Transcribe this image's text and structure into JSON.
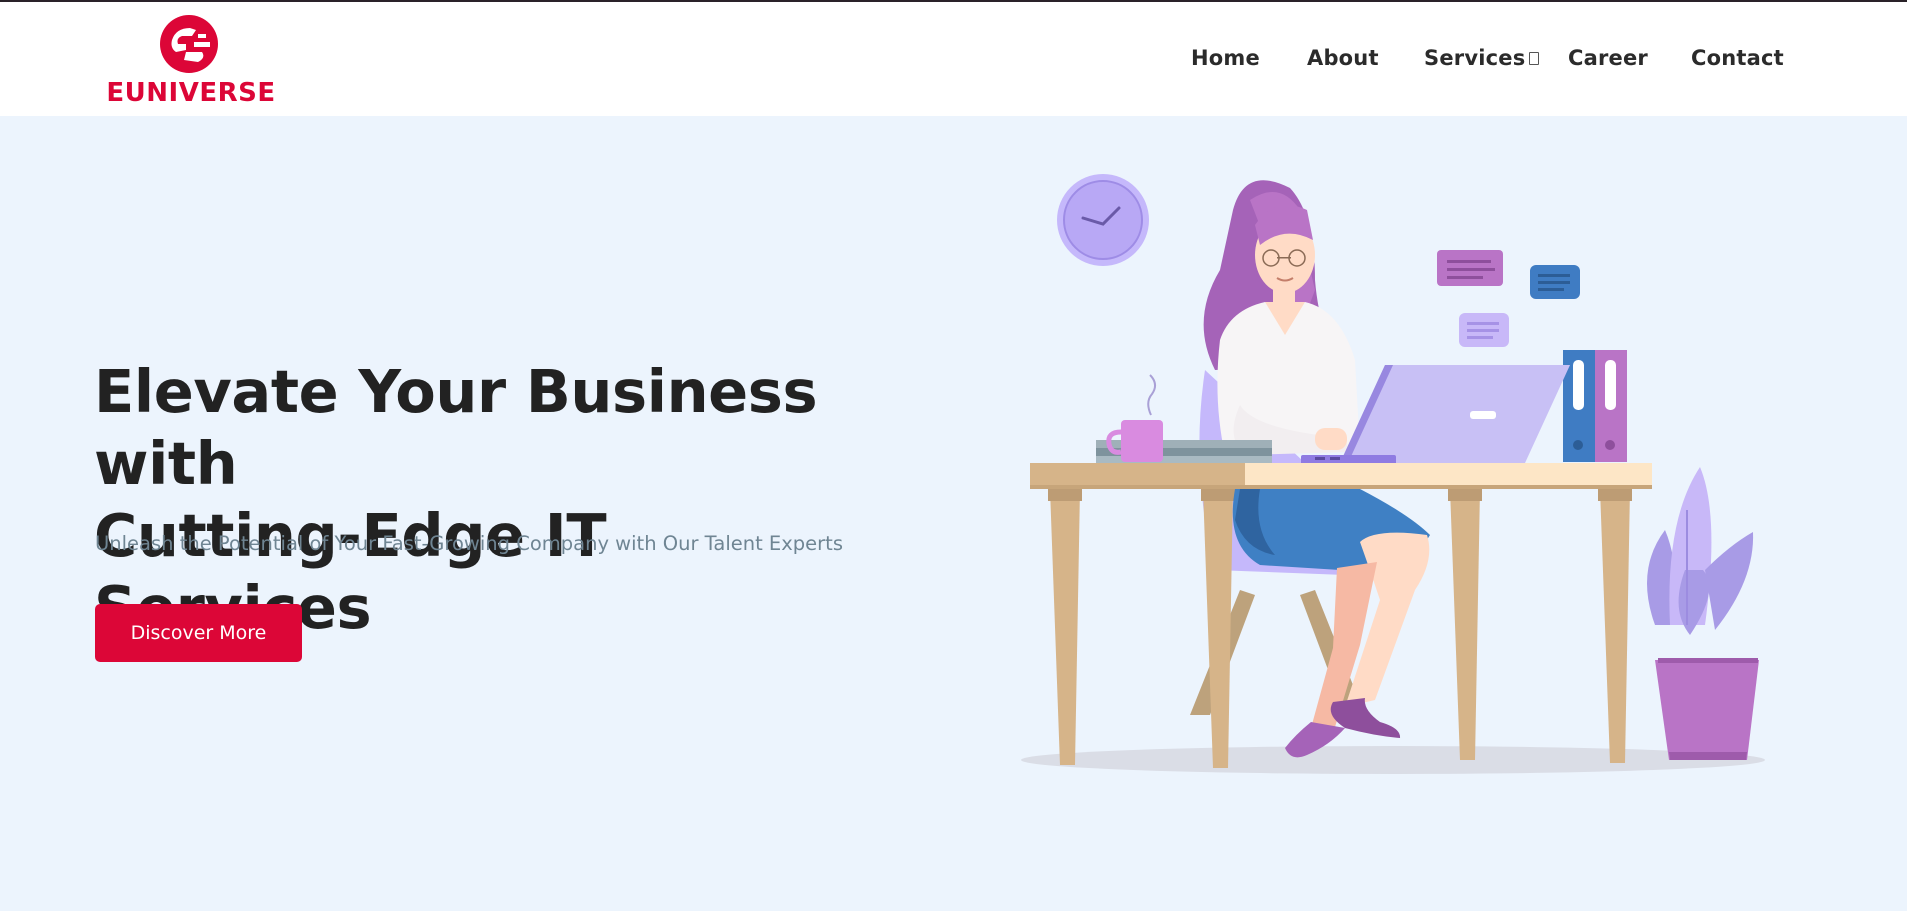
{
  "brand": {
    "name": "EUNIVERSE",
    "color": "#dc0637"
  },
  "nav": {
    "items": [
      {
        "label": "Home"
      },
      {
        "label": "About"
      },
      {
        "label": "Services",
        "has_dropdown": true
      },
      {
        "label": "Career"
      },
      {
        "label": "Contact"
      }
    ]
  },
  "hero": {
    "title_line1": "Elevate Your Business with",
    "title_line2": "Cutting-Edge IT Services",
    "subtitle": "Unleash the Potential of Your Fast-Growing Company with Our Talent Experts",
    "cta_label": "Discover More"
  },
  "colors": {
    "accent": "#dc0637",
    "background": "#ecf4fd",
    "heading": "#222222",
    "subtitle": "#6f8593"
  },
  "illustration": {
    "icon": "woman-at-desk-illustration"
  }
}
